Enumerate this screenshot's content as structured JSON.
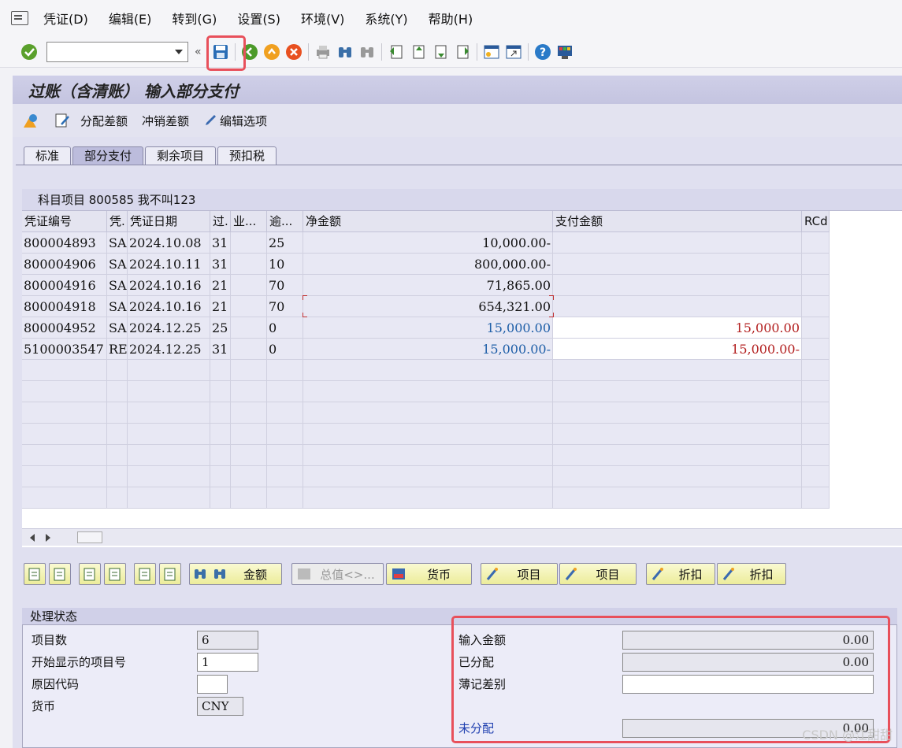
{
  "menu": [
    "凭证(D)",
    "编辑(E)",
    "转到(G)",
    "设置(S)",
    "环境(V)",
    "系统(Y)",
    "帮助(H)"
  ],
  "toolbar": {
    "command_value": "",
    "icons": [
      "check-icon",
      "save-icon",
      "back-icon",
      "exit-icon",
      "cancel-icon",
      "print-icon",
      "find-icon",
      "find-next-icon",
      "first-page-icon",
      "prev-page-icon",
      "next-page-icon",
      "last-page-icon",
      "new-session-icon",
      "shortcut-icon",
      "help-icon",
      "customize-icon"
    ]
  },
  "title": "过账（含清账） 输入部分支付",
  "app_toolbar": {
    "distribute": "分配差额",
    "writeoff": "冲销差额",
    "edit_options": "编辑选项"
  },
  "tabs": [
    "标准",
    "部分支付",
    "剩余项目",
    "预扣税"
  ],
  "active_tab": 1,
  "grid": {
    "title": "科目项目 800585 我不叫123",
    "columns": [
      "凭证编号",
      "凭.",
      "凭证日期",
      "过.",
      "业...",
      "逾...",
      "净金额",
      "支付金额",
      "RCd"
    ],
    "rows": [
      [
        "800004893",
        "SA",
        "2024.10.08",
        "31",
        "",
        "25",
        "10,000.00-",
        "",
        ""
      ],
      [
        "800004906",
        "SA",
        "2024.10.11",
        "31",
        "",
        "10",
        "800,000.00-",
        "",
        ""
      ],
      [
        "800004916",
        "SA",
        "2024.10.16",
        "21",
        "",
        "70",
        "71,865.00",
        "",
        ""
      ],
      [
        "800004918",
        "SA",
        "2024.10.16",
        "21",
        "",
        "70",
        "654,321.00",
        "",
        ""
      ],
      [
        "800004952",
        "SA",
        "2024.12.25",
        "25",
        "",
        "0",
        "15,000.00",
        "15,000.00",
        ""
      ],
      [
        "5100003547",
        "RE",
        "2024.12.25",
        "31",
        "",
        "0",
        "15,000.00-",
        "15,000.00-",
        ""
      ]
    ]
  },
  "buttons": {
    "amount": "金额",
    "total": "总值<>...",
    "currency": "货币",
    "item1": "项目",
    "item2": "项目",
    "discount1": "折扣",
    "discount2": "折扣"
  },
  "status": {
    "title": "处理状态",
    "item_count_label": "项目数",
    "item_count": "6",
    "first_item_label": "开始显示的项目号",
    "first_item": "1",
    "reason_label": "原因代码",
    "reason": "",
    "currency_label": "货币",
    "currency": "CNY",
    "entered_label": "输入金额",
    "entered": "0.00",
    "assigned_label": "已分配",
    "assigned": "0.00",
    "diff_label": "薄记差别",
    "diff": "",
    "unassigned_label": "未分配",
    "unassigned": "0.00"
  },
  "watermark": "CSDN @江甜甜"
}
